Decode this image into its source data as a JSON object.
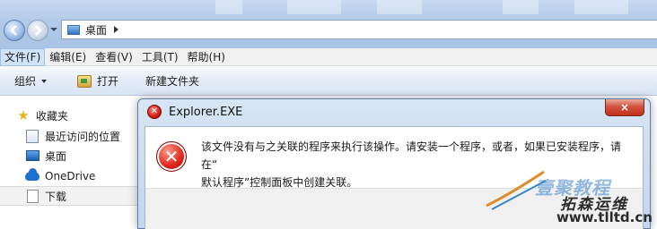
{
  "explorer": {
    "address": {
      "location": "桌面"
    },
    "menu": [
      {
        "label": "文件(F)",
        "active": true
      },
      {
        "label": "编辑(E)"
      },
      {
        "label": "查看(V)"
      },
      {
        "label": "工具(T)"
      },
      {
        "label": "帮助(H)"
      }
    ],
    "commands": {
      "organize": "组织",
      "open": "打开",
      "new_folder": "新建文件夹"
    },
    "navpane": {
      "favorites": "收藏夹",
      "items": [
        "最近访问的位置",
        "桌面",
        "OneDrive",
        "下载"
      ]
    }
  },
  "dialog": {
    "title": "Explorer.EXE",
    "close_label": "×",
    "message_line1": "该文件没有与之关联的程序来执行该操作。请安装一个程序，或者，如果已安装程序，请在“",
    "message_line2": "默认程序”控制面板中创建关联。"
  },
  "watermark": {
    "line1": "壹聚教程",
    "line2": "拓森运维",
    "line3": "www.tlltd.cn"
  },
  "colors": {
    "error_red": "#d21c14",
    "title_blue": "#b4cbe8"
  }
}
